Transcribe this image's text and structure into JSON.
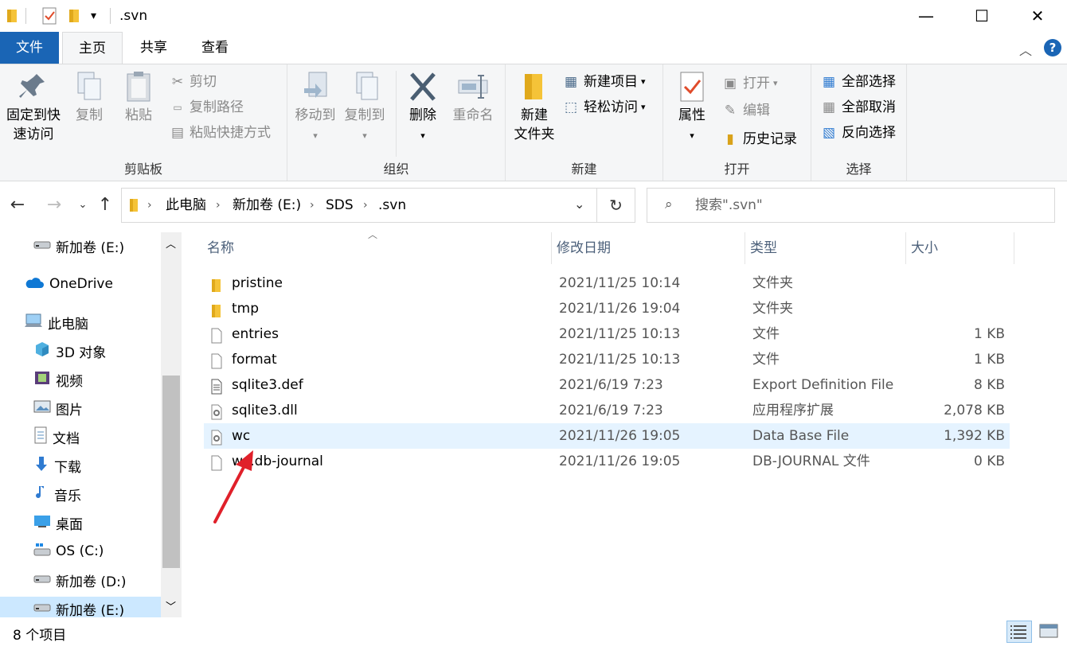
{
  "window": {
    "title": ".svn",
    "minimize": "—",
    "maximize": "☐",
    "close": "✕"
  },
  "tabs": {
    "file": "文件",
    "home": "主页",
    "share": "共享",
    "view": "查看"
  },
  "ribbon": {
    "clipboard": {
      "label": "剪贴板",
      "pin_line1": "固定到快",
      "pin_line2": "速访问",
      "copy": "复制",
      "paste": "粘贴",
      "cut": "剪切",
      "copy_path": "复制路径",
      "paste_shortcut": "粘贴快捷方式"
    },
    "organize": {
      "label": "组织",
      "move_to": "移动到",
      "copy_to": "复制到",
      "delete": "删除",
      "rename": "重命名"
    },
    "new": {
      "label": "新建",
      "new_folder_line1": "新建",
      "new_folder_line2": "文件夹",
      "new_item": "新建项目",
      "easy_access": "轻松访问"
    },
    "open": {
      "label": "打开",
      "properties": "属性",
      "open": "打开",
      "edit": "编辑",
      "history": "历史记录"
    },
    "select": {
      "label": "选择",
      "select_all": "全部选择",
      "select_none": "全部取消",
      "invert": "反向选择"
    }
  },
  "address": {
    "crumbs": [
      "此电脑",
      "新加卷 (E:)",
      "SDS",
      ".svn"
    ],
    "search_placeholder": "搜索\".svn\""
  },
  "nav": {
    "items": [
      {
        "label": "新加卷 (E:)",
        "icon": "drive-icon"
      },
      {
        "label": "OneDrive",
        "icon": "cloud-icon"
      },
      {
        "label": "此电脑",
        "icon": "computer-icon"
      },
      {
        "label": "3D 对象",
        "icon": "cube-icon"
      },
      {
        "label": "视频",
        "icon": "video-icon"
      },
      {
        "label": "图片",
        "icon": "picture-icon"
      },
      {
        "label": "文档",
        "icon": "document-icon"
      },
      {
        "label": "下载",
        "icon": "download-icon"
      },
      {
        "label": "音乐",
        "icon": "music-icon"
      },
      {
        "label": "桌面",
        "icon": "desktop-icon"
      },
      {
        "label": "OS (C:)",
        "icon": "windows-drive-icon"
      },
      {
        "label": "新加卷 (D:)",
        "icon": "drive-icon"
      },
      {
        "label": "新加卷 (E:)",
        "icon": "drive-icon"
      }
    ]
  },
  "columns": {
    "name": "名称",
    "date": "修改日期",
    "type": "类型",
    "size": "大小"
  },
  "files": [
    {
      "name": "pristine",
      "date": "2021/11/25 10:14",
      "type": "文件夹",
      "size": "",
      "icon": "folder-icon"
    },
    {
      "name": "tmp",
      "date": "2021/11/26 19:04",
      "type": "文件夹",
      "size": "",
      "icon": "folder-icon"
    },
    {
      "name": "entries",
      "date": "2021/11/25 10:13",
      "type": "文件",
      "size": "1 KB",
      "icon": "file-icon"
    },
    {
      "name": "format",
      "date": "2021/11/25 10:13",
      "type": "文件",
      "size": "1 KB",
      "icon": "file-icon"
    },
    {
      "name": "sqlite3.def",
      "date": "2021/6/19 7:23",
      "type": "Export Definition File",
      "size": "8 KB",
      "icon": "text-file-icon"
    },
    {
      "name": "sqlite3.dll",
      "date": "2021/6/19 7:23",
      "type": "应用程序扩展",
      "size": "2,078 KB",
      "icon": "dll-icon"
    },
    {
      "name": "wc",
      "date": "2021/11/26 19:05",
      "type": "Data Base File",
      "size": "1,392 KB",
      "icon": "db-file-icon"
    },
    {
      "name": "wc.db-journal",
      "date": "2021/11/26 19:05",
      "type": "DB-JOURNAL 文件",
      "size": "0 KB",
      "icon": "file-icon"
    }
  ],
  "status": {
    "count": "8 个项目"
  },
  "colors": {
    "accent": "#1a65b5",
    "selected_row": "#e5f3ff",
    "arrow": "#e0202a",
    "folder": "#f5c338"
  }
}
